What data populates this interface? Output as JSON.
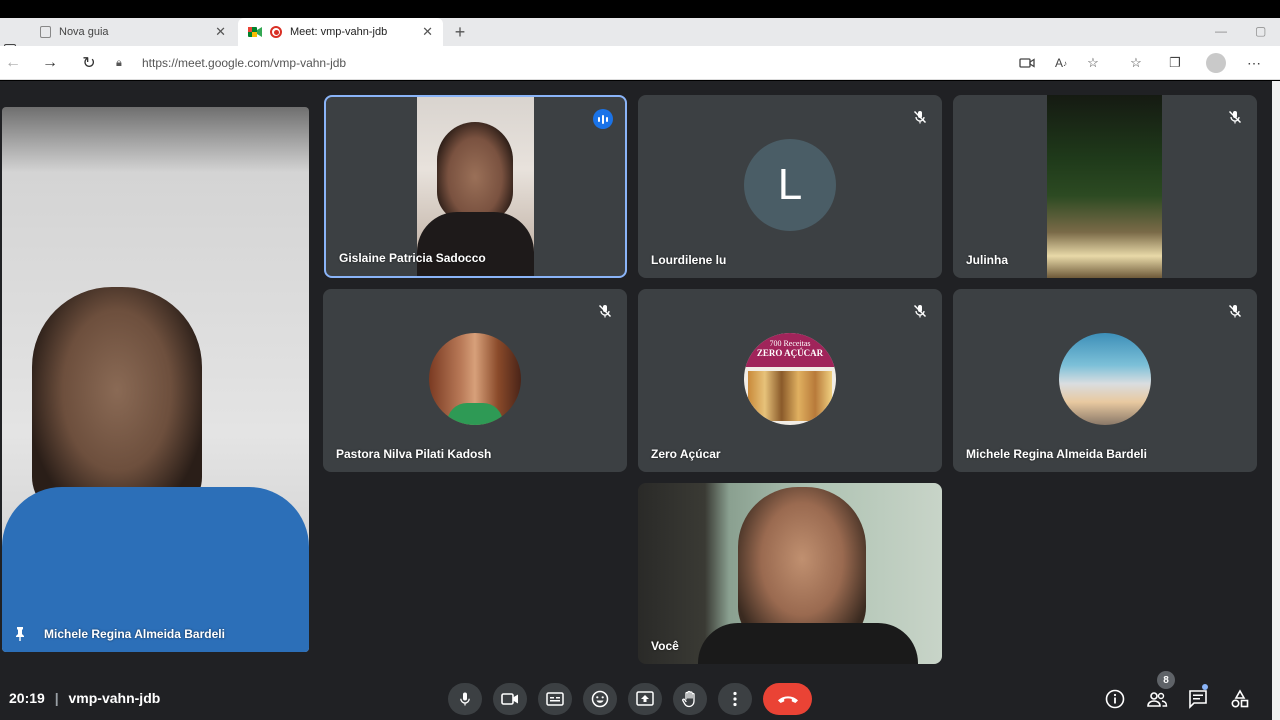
{
  "browser": {
    "tabs": [
      {
        "label": "Nova guia",
        "active": false
      },
      {
        "label": "Meet: vmp-vahn-jdb",
        "active": true
      }
    ],
    "url": "https://meet.google.com/vmp-vahn-jdb"
  },
  "meeting": {
    "time": "20:19",
    "code": "vmp-vahn-jdb",
    "participant_count": "8",
    "pinned": {
      "name": "Michele Regina Almeida Bardeli"
    },
    "tiles": [
      {
        "name": "Gislaine Patricia Sadocco",
        "state": "speaking"
      },
      {
        "name": "Lourdilene lu",
        "avatar_letter": "L",
        "state": "muted"
      },
      {
        "name": "Julinha",
        "state": "muted"
      },
      {
        "name": "Pastora Nilva Pilati Kadosh",
        "state": "muted"
      },
      {
        "name": "Zero Açúcar",
        "avatar_text_1": "700 Receitas",
        "avatar_text_2": "ZERO AÇÚCAR",
        "state": "muted"
      },
      {
        "name": "Michele Regina Almeida Bardeli",
        "state": "muted"
      },
      {
        "name": "Você"
      }
    ]
  },
  "colors": {
    "meet_bg": "#202124",
    "tile_bg": "#3c4043",
    "speaking_blue": "#1a73e8",
    "end_call_red": "#ea4335",
    "active_border": "#8ab4f8"
  },
  "icons": {
    "controls": [
      "mic-icon",
      "camera-icon",
      "captions-icon",
      "emoji-icon",
      "present-icon",
      "raise-hand-icon",
      "more-options-icon",
      "end-call-icon"
    ],
    "right": [
      "info-icon",
      "people-icon",
      "chat-icon",
      "activities-icon"
    ]
  }
}
